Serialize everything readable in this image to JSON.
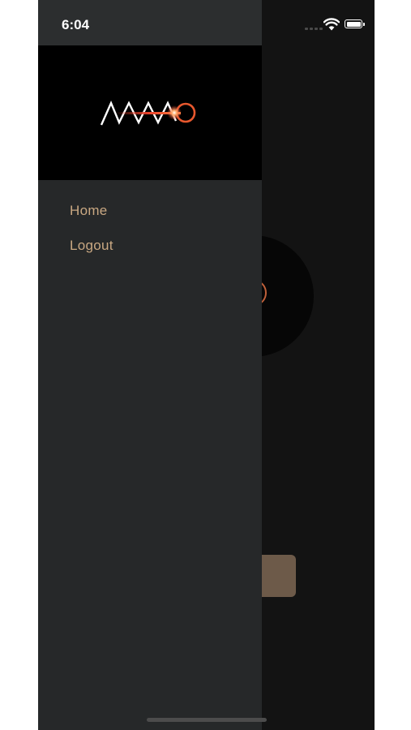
{
  "status_bar": {
    "time": "6:04"
  },
  "icons": {
    "wifi": "wifi-icon",
    "battery": "battery-icon",
    "signal": "signal-icon",
    "logo": "brand-logo"
  },
  "drawer": {
    "menu_items": [
      {
        "label": "Home"
      },
      {
        "label": "Logout"
      }
    ]
  },
  "colors": {
    "menu_text": "#c9a882",
    "drawer_bg": "#262829",
    "app_bg": "#131313",
    "accent_button": "#6d5a49",
    "logo_glow": "#e8402a"
  }
}
